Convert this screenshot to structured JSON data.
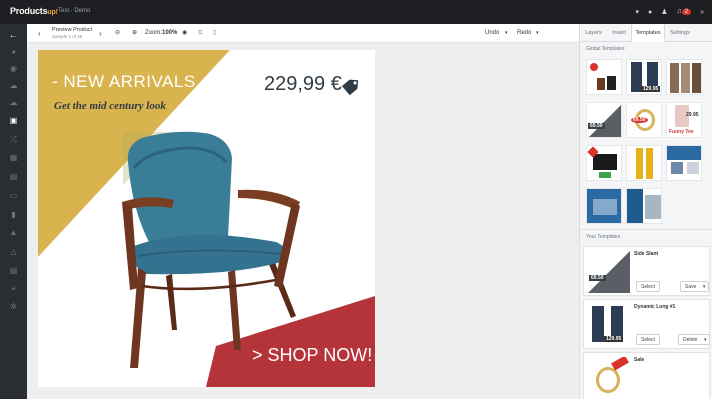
{
  "app": {
    "logo": "Products",
    "logo_sup": "up!",
    "project": "Test - Demo"
  },
  "topbar_icons": [
    "filter-icon",
    "help-icon",
    "user-icon",
    "bell-icon",
    "chevron-icon"
  ],
  "notification_count": "2",
  "toolbar": {
    "title": "Preview Product",
    "subtitle": "Sample 1 of 46",
    "zoom_label": "Zoom:",
    "zoom_value": "100%",
    "undo": "Undo",
    "redo": "Redo"
  },
  "canvas": {
    "headline": "- NEW ARRIVALS -",
    "tagline": "Get the mid century look",
    "price": "229,99 €",
    "cta": "> SHOP NOW!"
  },
  "panel": {
    "tabs": [
      "Layers",
      "Insert",
      "Templates",
      "Settings"
    ],
    "active_tab": "Templates",
    "global_label": "Global Templates",
    "your_label": "Your Templates",
    "global_thumbs": [
      {
        "badge": "",
        "price": ""
      },
      {
        "badge": "",
        "price": "129.95"
      },
      {
        "badge": "",
        "price": ""
      },
      {
        "badge": "",
        "price": "69.50"
      },
      {
        "badge": "",
        "price": "69.50"
      },
      {
        "badge": "",
        "price": "29.95"
      },
      {
        "badge": "",
        "price": ""
      },
      {
        "badge": "",
        "price": ""
      },
      {
        "badge": "",
        "price": ""
      },
      {
        "badge": "",
        "price": ""
      },
      {
        "badge": "",
        "price": ""
      }
    ],
    "global_thumb_extra": "Funny Tee",
    "your_templates": [
      {
        "name": "Side Slant",
        "price": "69.50",
        "select": "Select",
        "action": "Save"
      },
      {
        "name": "Dynamic Long #1",
        "price": "129.95",
        "select": "Select",
        "action": "Delete"
      },
      {
        "name": "Sale",
        "price": "",
        "select": "",
        "action": ""
      }
    ]
  },
  "colors": {
    "accent_yellow": "#d9b34e",
    "accent_red": "#b5343a",
    "chair_blue": "#3a7d96",
    "chair_wood": "#6e3620",
    "topbar": "#1d1f22",
    "rail": "#2a2d31"
  }
}
